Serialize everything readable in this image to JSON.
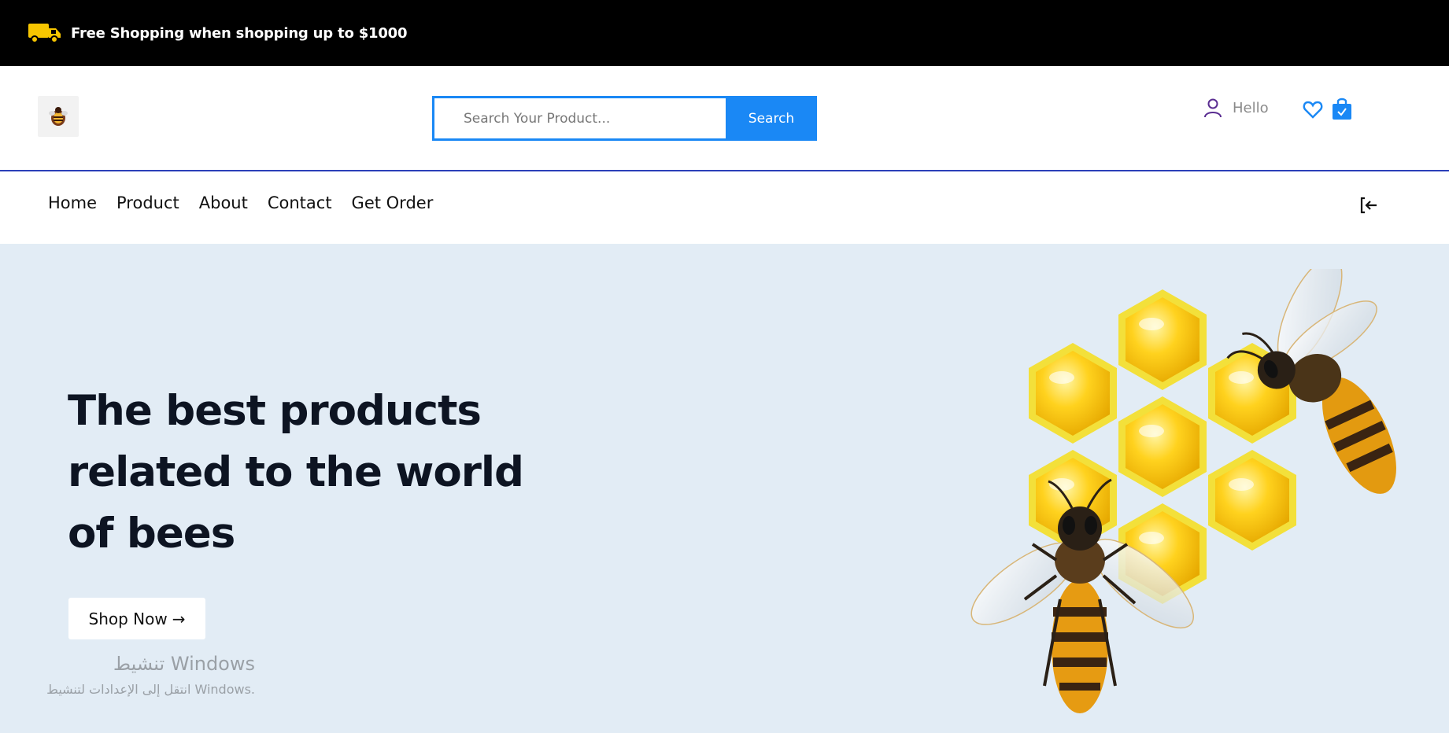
{
  "topbar": {
    "promo": "Free Shopping when shopping up to $1000",
    "icon": "truck-icon",
    "icon_color": "#f7c600"
  },
  "header": {
    "logo": "bee-logo",
    "search": {
      "placeholder": "Search Your Product...",
      "button": "Search"
    },
    "user": {
      "greeting": "Hello"
    },
    "accent": "#1a88f5"
  },
  "nav": {
    "items": [
      "Home",
      "Product",
      "About",
      "Contact",
      "Get Order"
    ]
  },
  "hero": {
    "title": "The best products related to the world of bees",
    "cta": "Shop Now",
    "cta_arrow": "→",
    "background": "#e2ecf5"
  },
  "watermark": {
    "line1": "تنشيط Windows",
    "line2": "انتقل إلى الإعدادات لتنشيط Windows."
  }
}
